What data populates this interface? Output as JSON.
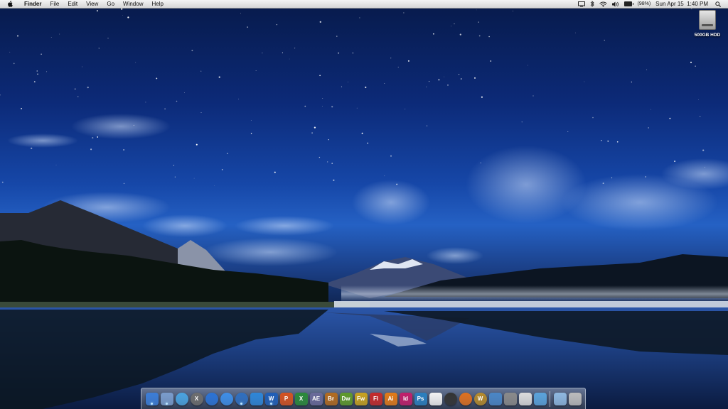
{
  "menubar": {
    "app_name": "Finder",
    "menus": [
      "File",
      "Edit",
      "View",
      "Go",
      "Window",
      "Help"
    ],
    "status": {
      "battery_percent_label": "(98%)",
      "battery_level": 0.98,
      "datetime": "Sun Apr 15  1:40 PM"
    },
    "icons": [
      "apple-icon",
      "display-icon",
      "bluetooth-icon",
      "wifi-icon",
      "volume-icon",
      "battery-icon",
      "spotlight-search-icon"
    ]
  },
  "desktop": {
    "icons": [
      {
        "label": "500GB HDD",
        "icon": "hard-drive-icon"
      }
    ]
  },
  "dock": {
    "apps": [
      {
        "id": "finder",
        "text": "",
        "color": "#3b7dd8",
        "running": true
      },
      {
        "id": "preview",
        "text": "",
        "color": "#7a9ccc",
        "running": true
      },
      {
        "id": "safari",
        "text": "",
        "color": "#4aa3e0",
        "round": true
      },
      {
        "id": "crossover",
        "text": "X",
        "color": "#6d6d6d",
        "round": true
      },
      {
        "id": "network-utility",
        "text": "",
        "color": "#2b73d6",
        "round": true
      },
      {
        "id": "app-store",
        "text": "",
        "color": "#3d8ee8",
        "round": true
      },
      {
        "id": "itunes",
        "text": "",
        "color": "#2f6fc0",
        "round": true,
        "running": true
      },
      {
        "id": "dropbox",
        "text": "",
        "color": "#2d86d8"
      },
      {
        "id": "word",
        "text": "W",
        "color": "#1f5fb8",
        "running": true
      },
      {
        "id": "powerpoint",
        "text": "P",
        "color": "#d5521f"
      },
      {
        "id": "excel",
        "text": "X",
        "color": "#2a8a3a"
      },
      {
        "id": "after-effects",
        "text": "AE",
        "color": "#6a6a9a"
      },
      {
        "id": "bridge",
        "text": "Br",
        "color": "#b36b1e"
      },
      {
        "id": "dreamweaver",
        "text": "Dw",
        "color": "#5e9a2a"
      },
      {
        "id": "fireworks",
        "text": "Fw",
        "color": "#c8a21e"
      },
      {
        "id": "flash",
        "text": "Fl",
        "color": "#c62a2a"
      },
      {
        "id": "illustrator",
        "text": "Ai",
        "color": "#e27a16"
      },
      {
        "id": "indesign",
        "text": "Id",
        "color": "#c21e6a"
      },
      {
        "id": "photoshop",
        "text": "Ps",
        "color": "#2a7fbf"
      },
      {
        "id": "acrobat",
        "text": "",
        "color": "#f2f2f2"
      },
      {
        "id": "dvd-player",
        "text": "",
        "color": "#333333",
        "round": true
      },
      {
        "id": "burn",
        "text": "",
        "color": "#e0701e",
        "round": true
      },
      {
        "id": "world-of-warcraft",
        "text": "W",
        "color": "#b58a2a",
        "round": true
      },
      {
        "id": "xcode-tools",
        "text": "",
        "color": "#4a86c6"
      },
      {
        "id": "steam",
        "text": "",
        "color": "#8a8a8a"
      },
      {
        "id": "mail",
        "text": "",
        "color": "#dcdcdc"
      },
      {
        "id": "facetime",
        "text": "",
        "color": "#5aa3dc"
      }
    ],
    "stacks": [
      {
        "id": "applications-folder",
        "color": "#8fb8e0"
      },
      {
        "id": "trash",
        "color": "#bcbcbc"
      }
    ]
  }
}
